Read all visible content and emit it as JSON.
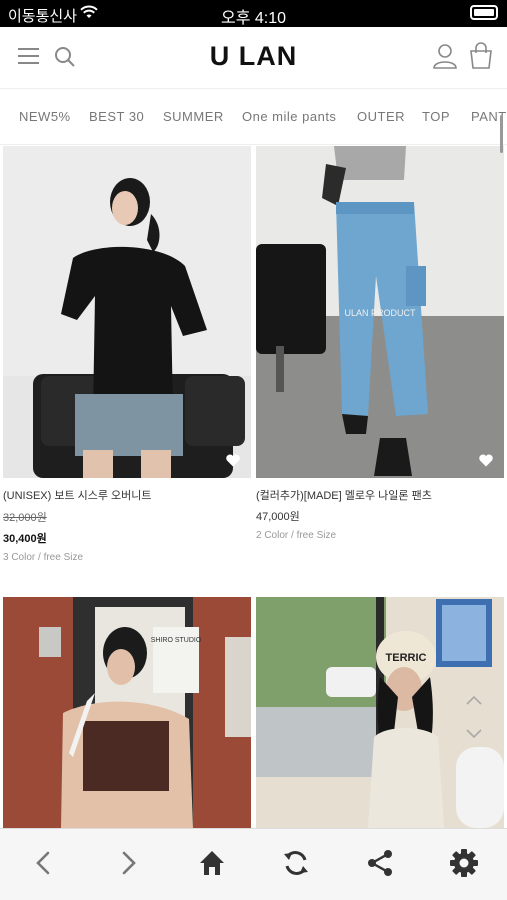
{
  "status_bar": {
    "carrier": "이동통신사",
    "time": "오후 4:10"
  },
  "header": {
    "logo": "U LAN",
    "cart_count": "0"
  },
  "tabs": [
    "NEW5%",
    "BEST 30",
    "SUMMER",
    "One mile pants",
    "OUTER",
    "TOP",
    "PANTS"
  ],
  "products": [
    {
      "name": "(UNISEX) 보트 시스루 오버니트",
      "original_price": "32,000원",
      "price": "30,400원",
      "options": "3 Color / free Size"
    },
    {
      "name": "(컬러추가)[MADE] 멜로우 나일론 팬츠",
      "price": "47,000원",
      "options": "2 Color / free Size",
      "watermark": "ULAN PRODUCT"
    },
    {
      "name": "",
      "price": "",
      "options": "",
      "sign_text": "SHIRO STUDIO"
    },
    {
      "name": "",
      "price": "",
      "options": "",
      "hat_text": "TERRIC"
    }
  ],
  "colors": {
    "accent": "#222222",
    "tab_text": "#777777",
    "bottom_bar": "#f6f6f6"
  },
  "bottom_bar": {
    "icons": [
      "back-icon",
      "forward-icon",
      "home-icon",
      "refresh-icon",
      "share-icon",
      "gear-icon"
    ]
  }
}
